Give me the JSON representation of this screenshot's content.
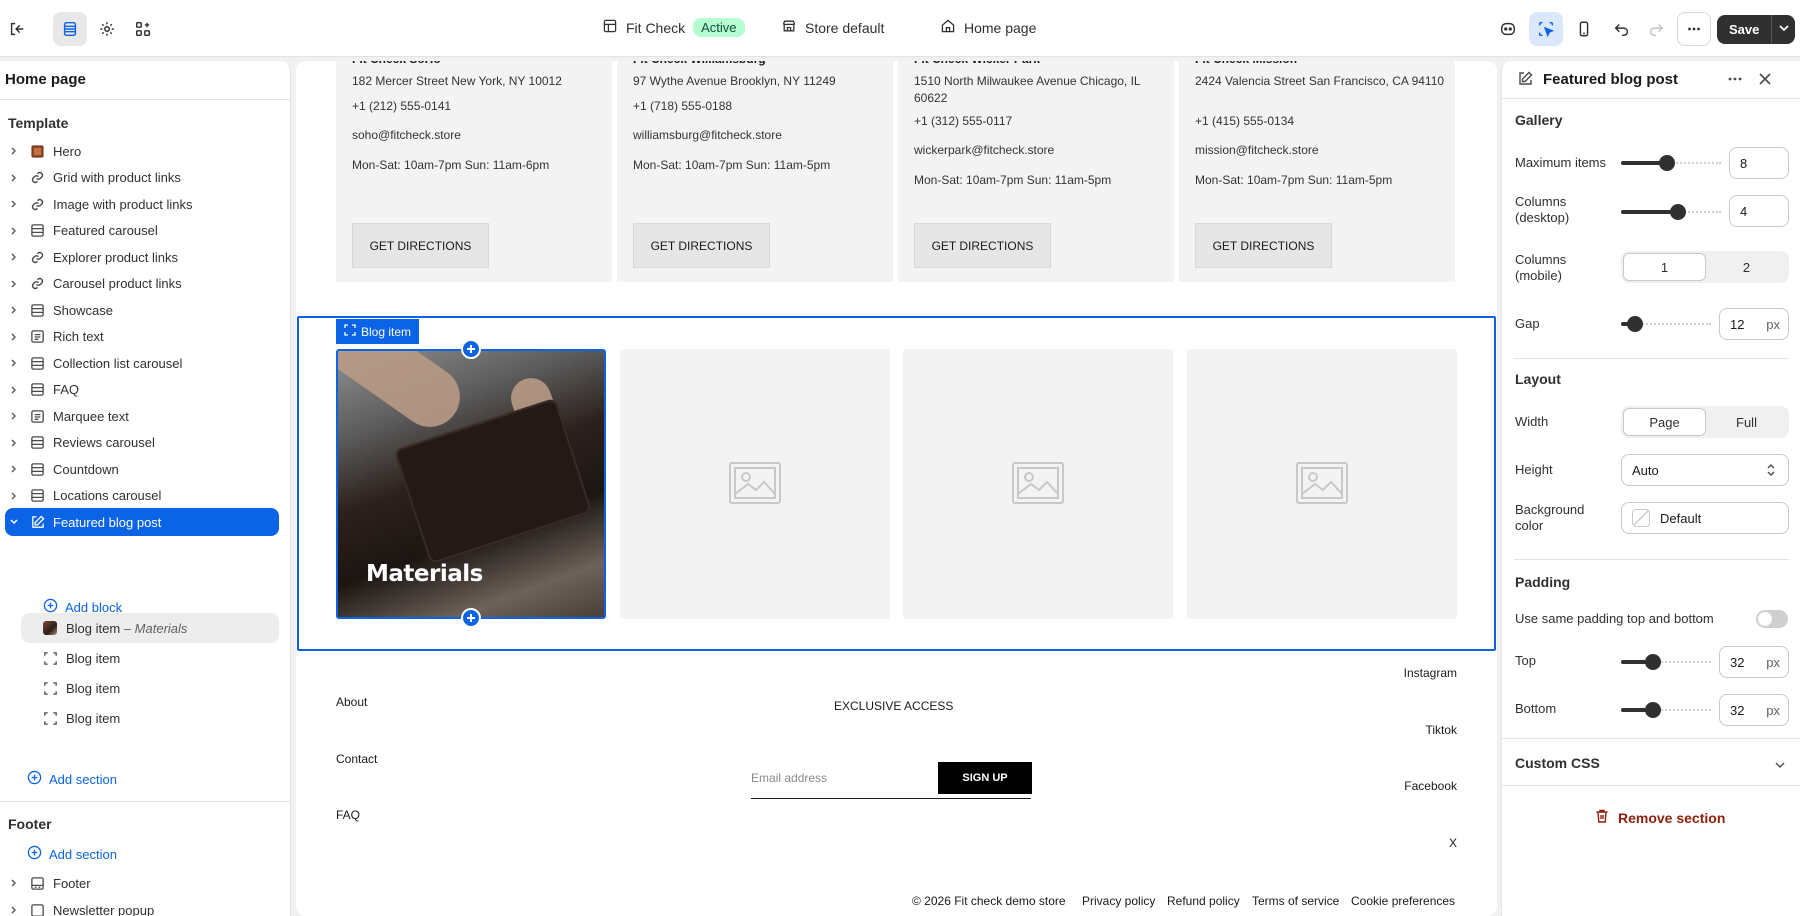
{
  "topbar": {
    "store_name": "Fit Check",
    "status": "Active",
    "theme_label": "Store default",
    "page_label": "Home page",
    "save_label": "Save"
  },
  "sidebar": {
    "title": "Home page",
    "template_label": "Template",
    "sections": [
      {
        "label": "Hero",
        "icon": "image-icon"
      },
      {
        "label": "Grid with product links",
        "icon": "link-icon"
      },
      {
        "label": "Image with product links",
        "icon": "link-icon"
      },
      {
        "label": "Featured carousel",
        "icon": "layout-icon"
      },
      {
        "label": "Explorer product links",
        "icon": "link-icon"
      },
      {
        "label": "Carousel product links",
        "icon": "link-icon"
      },
      {
        "label": "Showcase",
        "icon": "layout-icon"
      },
      {
        "label": "Rich text",
        "icon": "text-icon"
      },
      {
        "label": "Collection list carousel",
        "icon": "layout-icon"
      },
      {
        "label": "FAQ",
        "icon": "layout-icon"
      },
      {
        "label": "Marquee text",
        "icon": "text-icon"
      },
      {
        "label": "Reviews carousel",
        "icon": "layout-icon"
      },
      {
        "label": "Countdown",
        "icon": "layout-icon"
      },
      {
        "label": "Locations carousel",
        "icon": "layout-icon"
      },
      {
        "label": "Featured blog post",
        "icon": "edit-icon"
      }
    ],
    "add_block": "Add block",
    "blocks": [
      {
        "label": "Blog item",
        "sub": "– Materials"
      },
      {
        "label": "Blog item",
        "sub": ""
      },
      {
        "label": "Blog item",
        "sub": ""
      },
      {
        "label": "Blog item",
        "sub": ""
      }
    ],
    "add_section": "Add section",
    "footer_label": "Footer",
    "footer_add_section": "Add section",
    "footer_item": "Footer",
    "next_item": "Newsletter popup"
  },
  "canvas": {
    "locations": [
      {
        "name": "Fit Check SoHo",
        "address": "182 Mercer Street New York, NY 10012",
        "phone": "+1 (212) 555-0141",
        "email": "soho@fitcheck.store",
        "hours": "Mon-Sat: 10am-7pm Sun: 11am-6pm",
        "button": "GET DIRECTIONS"
      },
      {
        "name": "Fit Check Williamsburg",
        "address": "97 Wythe Avenue Brooklyn, NY 11249",
        "phone": "+1 (718) 555-0188",
        "email": "williamsburg@fitcheck.store",
        "hours": "Mon-Sat: 10am-7pm Sun: 11am-5pm",
        "button": "GET DIRECTIONS"
      },
      {
        "name": "Fit Check Wicker Park",
        "address": "1510 North Milwaukee Avenue Chicago, IL 60622",
        "phone": "+1 (312) 555-0117",
        "email": "wickerpark@fitcheck.store",
        "hours": "Mon-Sat: 10am-7pm Sun: 11am-5pm",
        "button": "GET DIRECTIONS"
      },
      {
        "name": "Fit Check Mission",
        "address": "2424 Valencia Street San Francisco, CA 94110",
        "phone": "+1 (415) 555-0134",
        "email": "mission@fitcheck.store",
        "hours": "Mon-Sat: 10am-7pm Sun: 11am-5pm",
        "button": "GET DIRECTIONS"
      }
    ],
    "block_tab": "Blog item",
    "blog_caption": "Materials",
    "footer": {
      "left_links": [
        "About",
        "Contact",
        "FAQ"
      ],
      "newsletter_heading": "EXCLUSIVE ACCESS",
      "email_placeholder": "Email address",
      "signup": "SIGN UP",
      "social": [
        "Instagram",
        "Tiktok",
        "Facebook",
        "X"
      ],
      "legal": [
        "© 2026 Fit check demo store",
        "Privacy policy",
        "Refund policy",
        "Terms of service",
        "Cookie preferences"
      ]
    }
  },
  "panel": {
    "title": "Featured blog post",
    "gallery_heading": "Gallery",
    "max_items_label": "Maximum items",
    "max_items": "8",
    "columns_desktop_label": "Columns (desktop)",
    "columns_desktop": "4",
    "columns_mobile_label": "Columns (mobile)",
    "columns_mobile_options": [
      "1",
      "2"
    ],
    "gap_label": "Gap",
    "gap": "12",
    "unit": "px",
    "layout_heading": "Layout",
    "width_label": "Width",
    "width_options": [
      "Page",
      "Full"
    ],
    "height_label": "Height",
    "height_value": "Auto",
    "bg_label": "Background color",
    "bg_value": "Default",
    "padding_heading": "Padding",
    "same_padding_label": "Use same padding top and bottom",
    "top_label": "Top",
    "top_value": "32",
    "bottom_label": "Bottom",
    "bottom_value": "32",
    "custom_css": "Custom CSS",
    "remove_section": "Remove section"
  },
  "colors": {
    "accent": "#0b63e5",
    "active_badge": "#b4fed2",
    "danger": "#8e1f0b"
  }
}
